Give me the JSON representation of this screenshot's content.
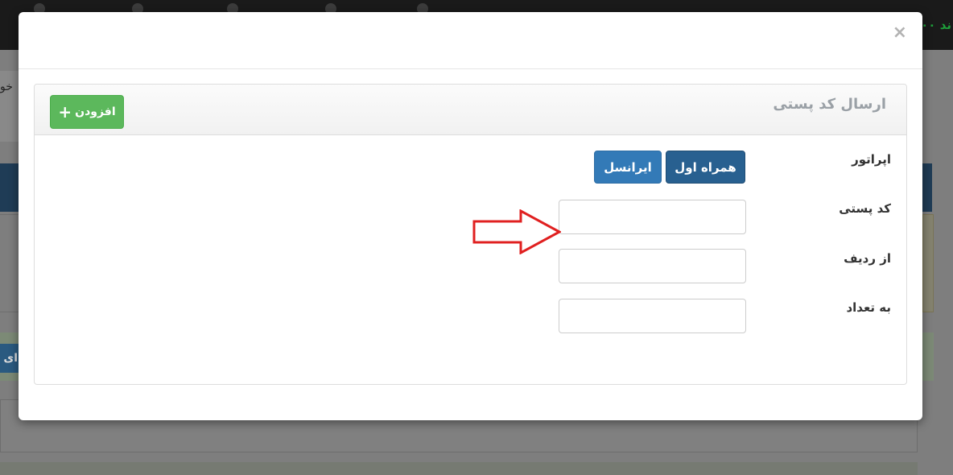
{
  "background": {
    "topbar_text": "ند ۰۰",
    "side_text": "خو",
    "side_button_label": "ای"
  },
  "modal": {
    "close_label": "×",
    "panel": {
      "title": "ارسال کد پستی",
      "add_button_label": "افزودن",
      "fields": {
        "operator_label": "اپراتور",
        "operator_options": [
          "همراه اول",
          "ایرانسل"
        ],
        "operator_selected": "همراه اول",
        "postal_code_label": "کد پستی",
        "postal_code_value": "",
        "from_row_label": "از ردیف",
        "from_row_value": "",
        "count_label": "به تعداد",
        "count_value": ""
      }
    }
  },
  "colors": {
    "success": "#5cb85c",
    "primary": "#337ab7",
    "primary_active": "#286090",
    "annotation_arrow": "#e02020"
  }
}
